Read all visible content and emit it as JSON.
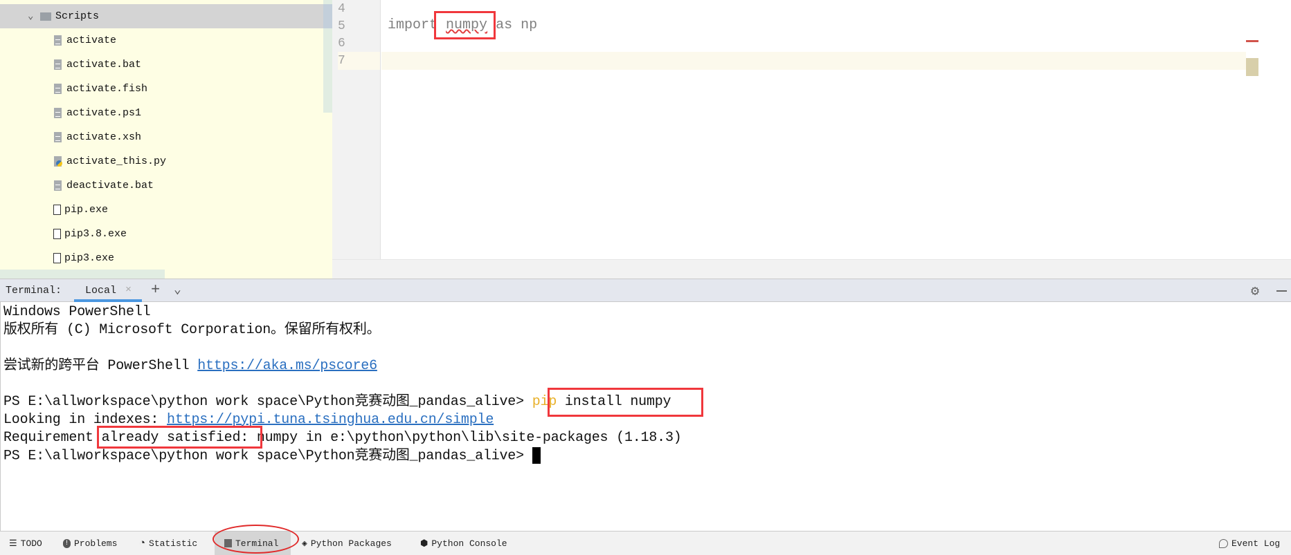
{
  "project_tree": {
    "folder": {
      "label": "Scripts",
      "expanded": true
    },
    "files": [
      {
        "label": "activate",
        "type": "text"
      },
      {
        "label": "activate.bat",
        "type": "text"
      },
      {
        "label": "activate.fish",
        "type": "text"
      },
      {
        "label": "activate.ps1",
        "type": "text"
      },
      {
        "label": "activate.xsh",
        "type": "text"
      },
      {
        "label": "activate_this.py",
        "type": "python"
      },
      {
        "label": "deactivate.bat",
        "type": "text"
      },
      {
        "label": "pip.exe",
        "type": "exe"
      },
      {
        "label": "pip3.8.exe",
        "type": "exe"
      },
      {
        "label": "pip3.exe",
        "type": "exe"
      }
    ]
  },
  "editor": {
    "line_numbers": [
      "4",
      "5",
      "6",
      "7"
    ],
    "code": {
      "kw": "import",
      "module": "numpy",
      "rest": "as np"
    },
    "colors": {
      "highlight": "#f0373c",
      "error_stripe": "#d1534b",
      "caret_line": "#fcf9ec"
    }
  },
  "terminal": {
    "title": "Terminal:",
    "tab": "Local",
    "lines": {
      "l1": "Windows PowerShell",
      "l2": "版权所有 (C) Microsoft Corporation。保留所有权利。",
      "l3_text": "尝试新的跨平台 PowerShell ",
      "l3_link": "https://aka.ms/pscore6",
      "prompt": "PS E:\\allworkspace\\python work space\\Python竞赛动图_pandas_alive> ",
      "cmd_pip": "pip",
      "cmd_rest": " install numpy",
      "l5_text": "Looking in indexes: ",
      "l5_link": "https://pypi.tuna.tsinghua.edu.cn/simple",
      "l6_a": "Requirement ",
      "l6_b": "already satisfied:",
      "l6_c": " numpy in e:\\python\\python\\lib\\site-packages (1.18.3)",
      "prompt2": "PS E:\\allworkspace\\python work space\\Python竞赛动图_pandas_alive> "
    }
  },
  "bottom_bar": {
    "items": [
      {
        "label": "TODO",
        "icon": "list-icon"
      },
      {
        "label": "Problems",
        "icon": "warning-icon"
      },
      {
        "label": "Statistic",
        "icon": "pie-icon"
      },
      {
        "label": "Terminal",
        "icon": "terminal-icon",
        "active": true
      },
      {
        "label": "Python Packages",
        "icon": "layers-icon"
      },
      {
        "label": "Python Console",
        "icon": "python-icon"
      }
    ],
    "event_log": "Event Log"
  }
}
